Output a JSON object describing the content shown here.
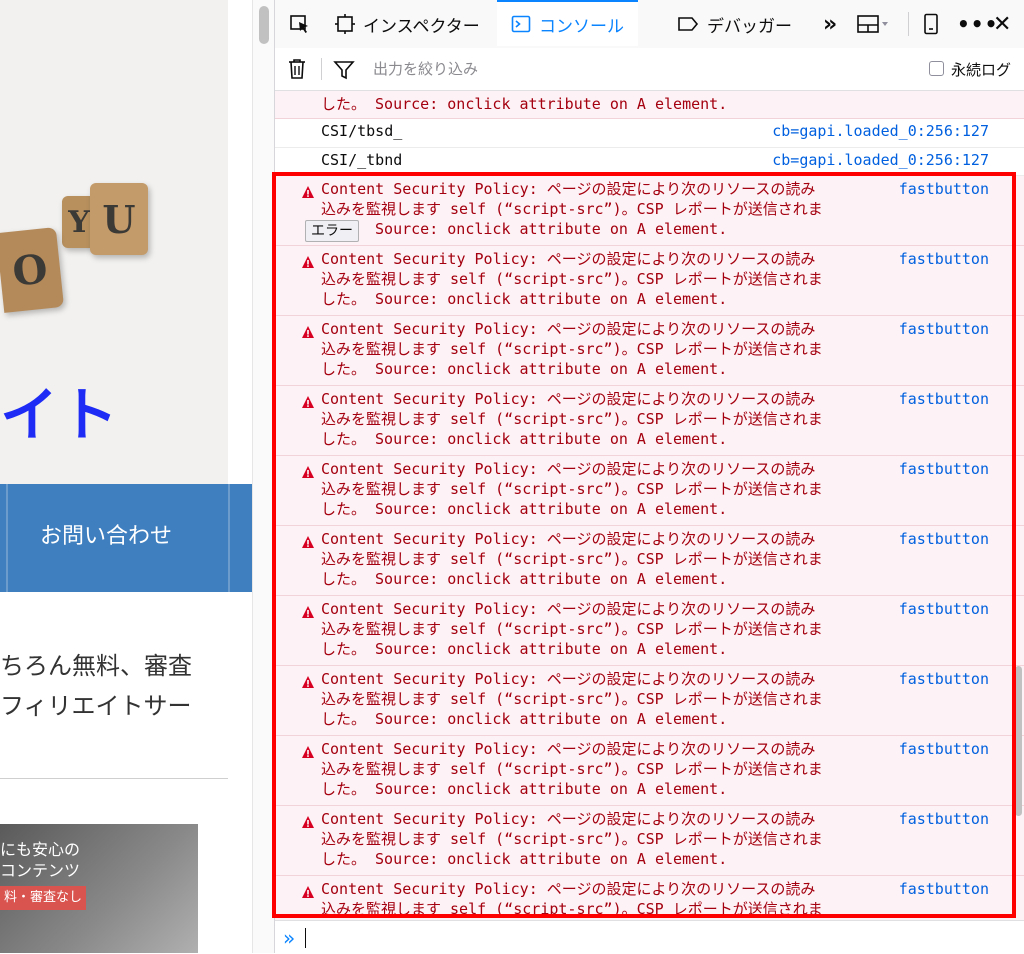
{
  "website": {
    "hero_title": "イト",
    "blocks": {
      "u": "U",
      "y": "Y",
      "o": "O"
    },
    "nav_contact": "お問い合わせ",
    "body_line1": "ちろん無料、審査",
    "body_line2": "フィリエイトサー",
    "banner_line1": "にも安心の",
    "banner_line2": "コンテンツ",
    "banner_badge": "料・審査なし"
  },
  "devtools": {
    "tabs": {
      "inspector": "インスペクター",
      "console": "コンソール",
      "debugger": "デバッガー",
      "more": "»",
      "menu": "•••",
      "close": "✕"
    },
    "filter": {
      "placeholder": "出力を絞り込み",
      "persist_label": "永続ログ"
    },
    "console": {
      "partial_message": "した。 Source: onclick attribute on A element.",
      "logs": [
        {
          "text": "CSI/tbsd_",
          "source": "cb=gapi.loaded_0:256:127"
        },
        {
          "text": "CSI/_tbnd",
          "source": "cb=gapi.loaded_0:256:127"
        }
      ],
      "error_badge": "エラー",
      "errors": [
        {
          "line1": "Content Security Policy: ページの設定により次のリソースの読み",
          "line2": "込みを監視します self (“script-src”)。CSP レポートが送信されま",
          "line3": "した。 Source: onclick attribute on A element.",
          "source": "fastbutton"
        },
        {
          "line1": "Content Security Policy: ページの設定により次のリソースの読み",
          "line2": "込みを監視します self (“script-src”)。CSP レポートが送信されま",
          "line3": "した。 Source: onclick attribute on A element.",
          "source": "fastbutton"
        },
        {
          "line1": "Content Security Policy: ページの設定により次のリソースの読み",
          "line2": "込みを監視します self (“script-src”)。CSP レポートが送信されま",
          "line3": "した。 Source: onclick attribute on A element.",
          "source": "fastbutton"
        },
        {
          "line1": "Content Security Policy: ページの設定により次のリソースの読み",
          "line2": "込みを監視します self (“script-src”)。CSP レポートが送信されま",
          "line3": "した。 Source: onclick attribute on A element.",
          "source": "fastbutton"
        },
        {
          "line1": "Content Security Policy: ページの設定により次のリソースの読み",
          "line2": "込みを監視します self (“script-src”)。CSP レポートが送信されま",
          "line3": "した。 Source: onclick attribute on A element.",
          "source": "fastbutton"
        },
        {
          "line1": "Content Security Policy: ページの設定により次のリソースの読み",
          "line2": "込みを監視します self (“script-src”)。CSP レポートが送信されま",
          "line3": "した。 Source: onclick attribute on A element.",
          "source": "fastbutton"
        },
        {
          "line1": "Content Security Policy: ページの設定により次のリソースの読み",
          "line2": "込みを監視します self (“script-src”)。CSP レポートが送信されま",
          "line3": "した。 Source: onclick attribute on A element.",
          "source": "fastbutton"
        },
        {
          "line1": "Content Security Policy: ページの設定により次のリソースの読み",
          "line2": "込みを監視します self (“script-src”)。CSP レポートが送信されま",
          "line3": "した。 Source: onclick attribute on A element.",
          "source": "fastbutton"
        },
        {
          "line1": "Content Security Policy: ページの設定により次のリソースの読み",
          "line2": "込みを監視します self (“script-src”)。CSP レポートが送信されま",
          "line3": "した。 Source: onclick attribute on A element.",
          "source": "fastbutton"
        },
        {
          "line1": "Content Security Policy: ページの設定により次のリソースの読み",
          "line2": "込みを監視します self (“script-src”)。CSP レポートが送信されま",
          "line3": "した。 Source: onclick attribute on A element.",
          "source": "fastbutton"
        },
        {
          "line1": "Content Security Policy: ページの設定により次のリソースの読み",
          "line2": "込みを監視します self (“script-src”)。CSP レポートが送信されま",
          "line3": "",
          "source": "fastbutton"
        }
      ],
      "prompt": "»"
    },
    "colors": {
      "accent": "#0a84ff",
      "error_text": "#a4000f",
      "error_bg": "#fdf2f5",
      "link": "#0060df",
      "highlight": "#ff0000"
    }
  }
}
